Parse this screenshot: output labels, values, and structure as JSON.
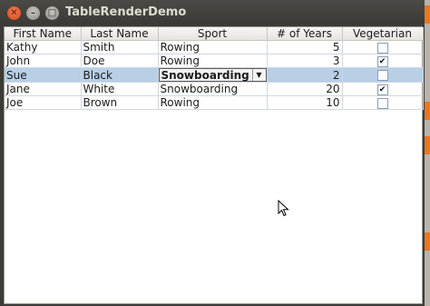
{
  "window": {
    "title": "TableRenderDemo"
  },
  "table": {
    "headers": [
      "First Name",
      "Last Name",
      "Sport",
      "# of Years",
      "Vegetarian"
    ],
    "rows": [
      {
        "first": "Kathy",
        "last": "Smith",
        "sport": "Rowing",
        "years": "5",
        "vegetarian": false
      },
      {
        "first": "John",
        "last": "Doe",
        "sport": "Rowing",
        "years": "3",
        "vegetarian": true
      },
      {
        "first": "Sue",
        "last": "Black",
        "sport": "Snowboarding",
        "years": "2",
        "vegetarian": false,
        "selected": true,
        "editing": true
      },
      {
        "first": "Jane",
        "last": "White",
        "sport": "Snowboarding",
        "years": "20",
        "vegetarian": true
      },
      {
        "first": "Joe",
        "last": "Brown",
        "sport": "Rowing",
        "years": "10",
        "vegetarian": false
      }
    ]
  },
  "colors": {
    "selection": "#b8cfe5",
    "titlebar": "#3c3b37",
    "close": "#e2522a"
  },
  "icons": [
    "close-icon",
    "minimize-icon",
    "maximize-icon",
    "checkmark-icon",
    "dropdown-arrow-icon",
    "mouse-pointer-icon"
  ]
}
